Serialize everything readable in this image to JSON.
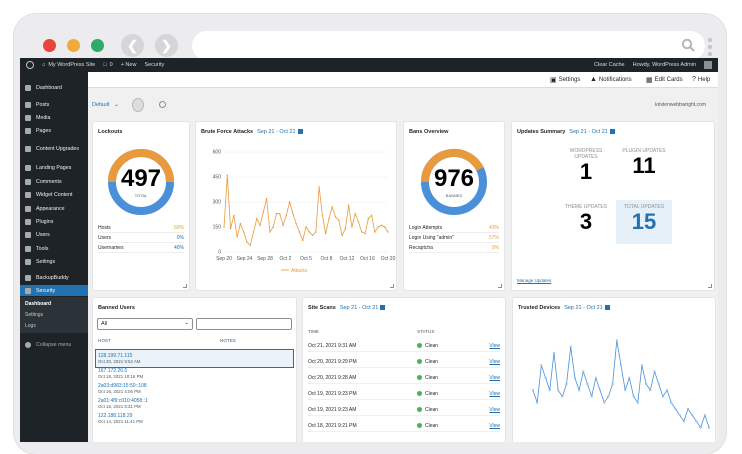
{
  "admin_bar": {
    "site": "My WordPress Site",
    "comments": "0",
    "new": "+ New",
    "security": "Security",
    "clear_cache": "Clear Cache",
    "howdy": "Howdy, WordPress Admin"
  },
  "sidebar": {
    "items": [
      {
        "label": "Dashboard",
        "icon": "dashboard-icon"
      },
      {
        "label": "Posts",
        "icon": "pin-icon"
      },
      {
        "label": "Media",
        "icon": "media-icon"
      },
      {
        "label": "Pages",
        "icon": "page-icon"
      },
      {
        "label": "Content Upgrades",
        "icon": "upgrade-icon"
      },
      {
        "label": "Landing Pages",
        "icon": "landing-icon"
      },
      {
        "label": "Comments",
        "icon": "comment-icon"
      },
      {
        "label": "Widget Content",
        "icon": "widget-icon"
      },
      {
        "label": "Appearance",
        "icon": "brush-icon"
      },
      {
        "label": "Plugins",
        "icon": "plugin-icon"
      },
      {
        "label": "Users",
        "icon": "users-icon"
      },
      {
        "label": "Tools",
        "icon": "tools-icon"
      },
      {
        "label": "Settings",
        "icon": "settings-icon"
      },
      {
        "label": "BackupBuddy",
        "icon": "backup-icon"
      },
      {
        "label": "Security",
        "icon": "shield-icon"
      }
    ],
    "sub": [
      "Dashboard",
      "Settings",
      "Logs"
    ],
    "collapse": "Collapse menu"
  },
  "topbar": {
    "settings": "Settings",
    "notifications": "Notifications",
    "edit_cards": "Edit Cards",
    "help": "Help"
  },
  "subbar": {
    "view": "Default",
    "email": "kristenwebbwright.com"
  },
  "lockouts": {
    "title": "Lockouts",
    "total": "497",
    "total_label": "TOTAL",
    "rows": [
      {
        "label": "Hosts",
        "value": "60%"
      },
      {
        "label": "Users",
        "value": "0%"
      },
      {
        "label": "Usernames",
        "value": "40%"
      }
    ]
  },
  "brute": {
    "title": "Brute Force Attacks",
    "range": "Sep 21 - Oct 21",
    "legend": "Attacks",
    "yticks": [
      "600",
      "450",
      "300",
      "150",
      "0"
    ],
    "xticks": [
      "Sep 20",
      "Sep 24",
      "Sep 28",
      "Oct 2",
      "Oct 5",
      "Oct 8",
      "Oct 12",
      "Oct 16",
      "Oct 20"
    ]
  },
  "bans": {
    "title": "Bans Overview",
    "total": "976",
    "total_label": "BANNED",
    "rows": [
      {
        "label": "Login Attempts",
        "value": "43%"
      },
      {
        "label": "Login Using \"admin\"",
        "value": "57%"
      },
      {
        "label": "Recaptcha",
        "value": "0%"
      }
    ]
  },
  "updates": {
    "title": "Updates Summary",
    "range": "Sep 21 - Oct 21",
    "items": [
      {
        "label": "WORDPRESS UPDATES",
        "value": "1"
      },
      {
        "label": "PLUGIN UPDATES",
        "value": "11"
      },
      {
        "label": "THEME UPDATES",
        "value": "3"
      },
      {
        "label": "TOTAL UPDATES",
        "value": "15"
      }
    ],
    "manage": "Manage Updates"
  },
  "banned_users": {
    "title": "Banned Users",
    "filter": "All",
    "col_host": "HOST",
    "col_notes": "NOTES",
    "rows": [
      {
        "host": "128.199.71.115",
        "date": "Oct 20, 2021 9:52 AM"
      },
      {
        "host": "167.172.26.5",
        "date": "Oct 18, 2021 10:16 PM"
      },
      {
        "host": "2a03:d983:15:50::108",
        "date": "Oct 16, 2021 4:06 PM"
      },
      {
        "host": "2a01:4f9:c010:4058::1",
        "date": "Oct 16, 2021 5:31 PM"
      },
      {
        "host": "122.188.118.29",
        "date": "Oct 14, 2021 11:41 PM"
      }
    ]
  },
  "site_scans": {
    "title": "Site Scans",
    "range": "Sep 21 - Oct 21",
    "col_time": "TIME",
    "col_status": "STATUS",
    "view": "View",
    "rows": [
      {
        "time": "Oct 21, 2021 9:31 AM",
        "status": "Clean"
      },
      {
        "time": "Oct 20, 2021 9:29 PM",
        "status": "Clean"
      },
      {
        "time": "Oct 20, 2021 9:28 AM",
        "status": "Clean"
      },
      {
        "time": "Oct 19, 2021 9:23 PM",
        "status": "Clean"
      },
      {
        "time": "Oct 19, 2021 9:23 AM",
        "status": "Clean"
      },
      {
        "time": "Oct 18, 2021 9:21 PM",
        "status": "Clean"
      }
    ]
  },
  "trusted": {
    "title": "Trusted Devices",
    "range": "Sep 21 - Oct 21"
  },
  "colors": {
    "orange": "#e89a3c",
    "blue": "#4a90d9",
    "wp_blue": "#2271b1",
    "sidebar": "#1d2327"
  },
  "chart_data": [
    {
      "type": "line",
      "title": "Brute Force Attacks",
      "ylim": [
        0,
        600
      ],
      "series": [
        {
          "name": "Attacks",
          "values": [
            150,
            460,
            140,
            220,
            90,
            170,
            120,
            60,
            40,
            120,
            200,
            160,
            240,
            320,
            120,
            150,
            230,
            230,
            160,
            220,
            300,
            230,
            170,
            120,
            70,
            150,
            120,
            100,
            120,
            390,
            220,
            110,
            200,
            270,
            210,
            190,
            100,
            140,
            280,
            150,
            230,
            180,
            120,
            110,
            200,
            220,
            120,
            150,
            160,
            150,
            120
          ]
        }
      ]
    },
    {
      "type": "line",
      "title": "Trusted Devices",
      "series": [
        {
          "values": [
            40,
            30,
            60,
            50,
            40,
            70,
            40,
            35,
            45,
            75,
            50,
            40,
            55,
            45,
            35,
            50,
            40,
            30,
            35,
            45,
            80,
            60,
            40,
            50,
            35,
            30,
            60,
            45,
            40,
            55,
            45,
            35,
            40,
            30,
            25,
            20,
            15,
            25,
            20,
            15,
            10,
            20,
            10
          ]
        }
      ]
    }
  ]
}
